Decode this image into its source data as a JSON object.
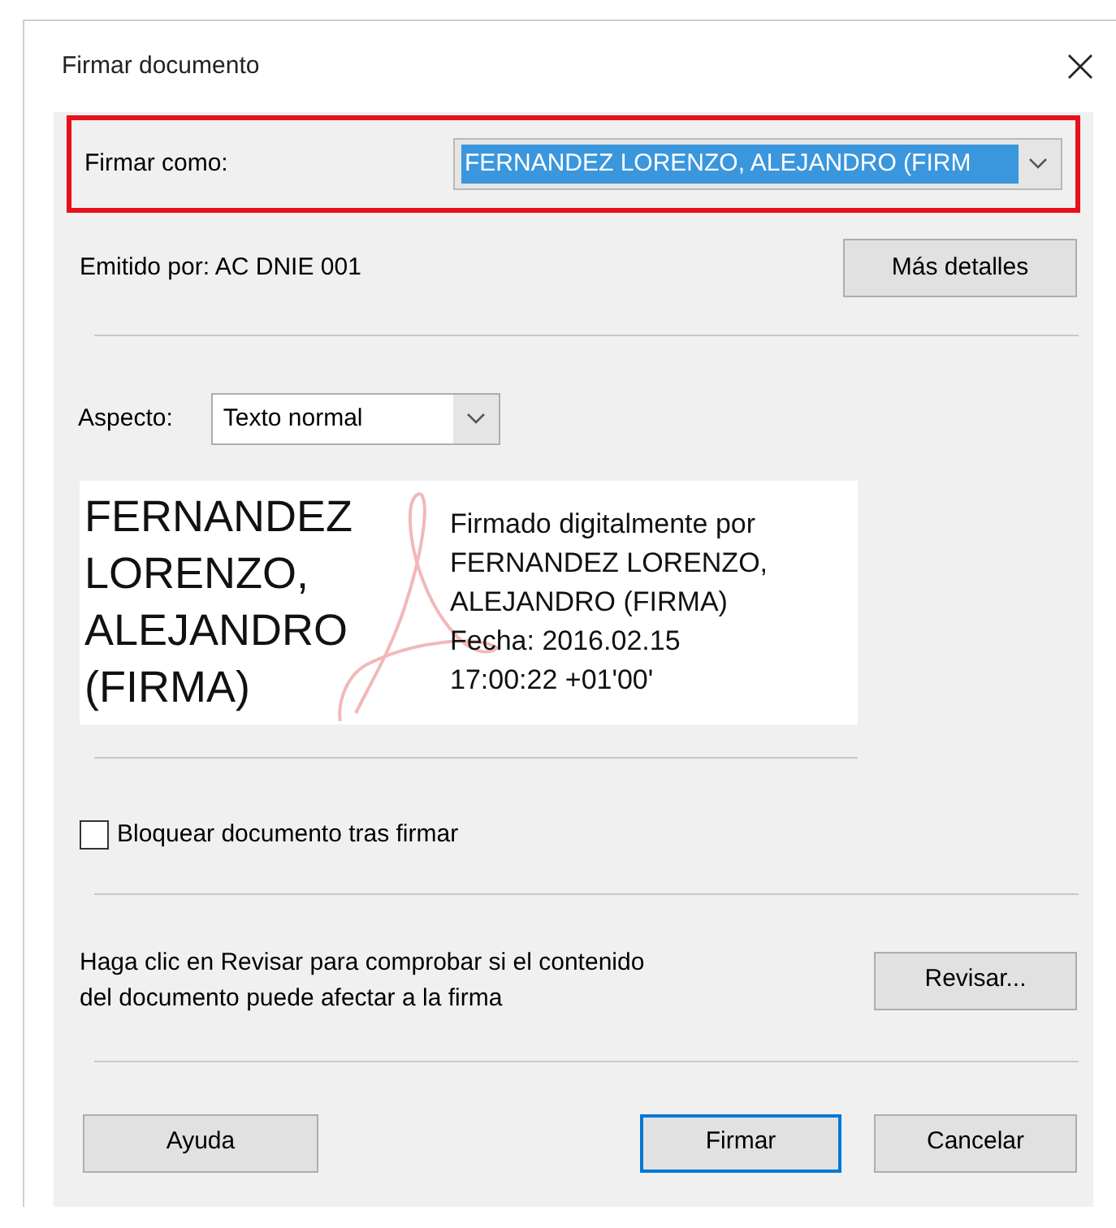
{
  "window": {
    "title": "Firmar documento"
  },
  "sign_as": {
    "label": "Firmar como:",
    "value": "FERNANDEZ LORENZO, ALEJANDRO (FIRM",
    "highlighted": true
  },
  "issuer": {
    "text": "Emitido por: AC DNIE 001",
    "button": "Más detalles"
  },
  "appearance": {
    "label": "Aspecto:",
    "value": "Texto normal"
  },
  "preview": {
    "name_lines": [
      "FERNANDEZ",
      "LORENZO,",
      "ALEJANDRO",
      "(FIRMA)"
    ],
    "detail_lines": [
      "Firmado digitalmente por",
      "FERNANDEZ LORENZO,",
      "ALEJANDRO (FIRMA)",
      "Fecha: 2016.02.15",
      "17:00:22 +01'00'"
    ]
  },
  "lock": {
    "label": "Bloquear documento tras firmar",
    "checked": false
  },
  "review": {
    "text_lines": [
      "Haga clic en Revisar para comprobar si el contenido",
      "del documento puede afectar a la firma"
    ],
    "button": "Revisar..."
  },
  "buttons": [
    {
      "label": "Ayuda",
      "default": false
    },
    {
      "label": "Firmar",
      "default": true
    },
    {
      "label": "Cancelar",
      "default": false
    }
  ]
}
